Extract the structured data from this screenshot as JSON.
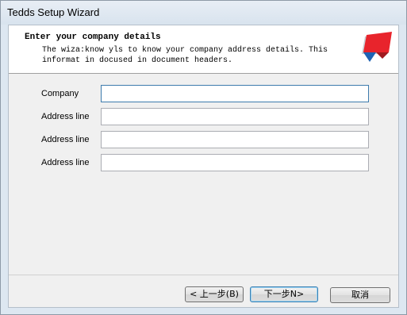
{
  "window": {
    "title": "Tedds Setup Wizard"
  },
  "header": {
    "title": "Enter your company details",
    "description": "The wiza:know yls to know your company address details. This\ninformat in docused in document headers."
  },
  "fields": [
    {
      "label": "Company",
      "value": ""
    },
    {
      "label": "Address line",
      "value": ""
    },
    {
      "label": "Address line",
      "value": ""
    },
    {
      "label": "Address line",
      "value": ""
    }
  ],
  "buttons": {
    "back": "< 上一步(B)",
    "next": "下一步N>",
    "cancel": "取消"
  },
  "colors": {
    "logo_red": "#e8242c",
    "logo_dark_red": "#a01a20",
    "logo_blue": "#1e63b4",
    "logo_grey": "#c8cdd2"
  }
}
